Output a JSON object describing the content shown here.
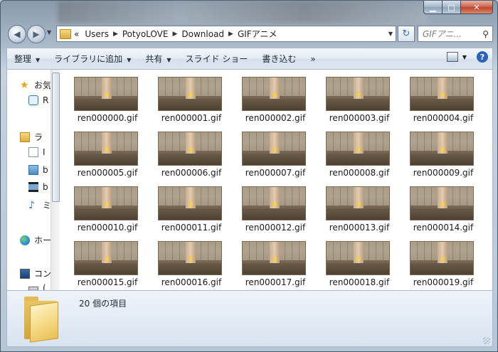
{
  "window": {
    "caption_buttons": {
      "minimize": "▁",
      "maximize": "□",
      "close": "✕"
    }
  },
  "nav": {
    "back_glyph": "◀",
    "forward_glyph": "▶",
    "history_glyph": "▼",
    "address": {
      "prefix": "«",
      "crumbs": [
        "Users",
        "PotyoLOVE",
        "Download",
        "GIFアニメ"
      ],
      "separator": "▶",
      "dropdown_glyph": "▼"
    },
    "refresh_glyph": "↻",
    "search_placeholder": "GIFアニ...",
    "search_icon": "⚲"
  },
  "toolbar": {
    "items": [
      {
        "label": "整理",
        "has_menu": true
      },
      {
        "label": "ライブラリに追加",
        "has_menu": true
      },
      {
        "label": "共有",
        "has_menu": true
      },
      {
        "label": "スライド ショー",
        "has_menu": false
      },
      {
        "label": "書き込む",
        "has_menu": false
      },
      {
        "label": "»",
        "has_menu": false
      }
    ],
    "view_caret": "▼",
    "help_label": "?"
  },
  "nav_pane": {
    "items": [
      {
        "label": "お気",
        "icon": "star-icon"
      },
      {
        "label": "R",
        "icon": "recent-places-icon"
      },
      {
        "label": "ラ",
        "icon": "libraries-icon"
      },
      {
        "label": "I",
        "icon": "documents-icon"
      },
      {
        "label": "b",
        "icon": "pictures-icon"
      },
      {
        "label": "b",
        "icon": "videos-icon"
      },
      {
        "label": "ミ",
        "icon": "music-icon"
      },
      {
        "label": "ホー",
        "icon": "homegroup-icon"
      },
      {
        "label": "コン",
        "icon": "computer-icon"
      },
      {
        "label": "(",
        "icon": "drive-icon"
      }
    ]
  },
  "files": [
    "ren000000.gif",
    "ren000001.gif",
    "ren000002.gif",
    "ren000003.gif",
    "ren000004.gif",
    "ren000005.gif",
    "ren000006.gif",
    "ren000007.gif",
    "ren000008.gif",
    "ren000009.gif",
    "ren000010.gif",
    "ren000011.gif",
    "ren000012.gif",
    "ren000013.gif",
    "ren000014.gif",
    "ren000015.gif",
    "ren000016.gif",
    "ren000017.gif",
    "ren000018.gif",
    "ren000019.gif"
  ],
  "details": {
    "item_count": "20 個の項目"
  },
  "colors": {
    "accent": "#2a62b6",
    "folder": "#e9c463",
    "close_button": "#c0452b"
  }
}
